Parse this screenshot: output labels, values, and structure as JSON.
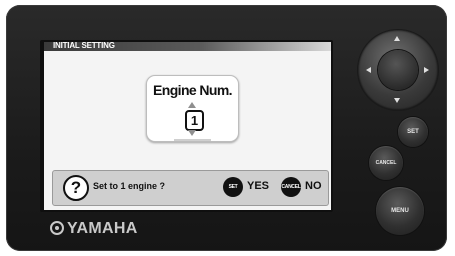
{
  "screen": {
    "title": "INITIAL SETTING",
    "panel": {
      "title": "Engine Num.",
      "value": "1"
    },
    "prompt": {
      "text": "Set to 1 engine ?",
      "set_button": "SET",
      "yes_label": "YES",
      "cancel_button": "CANCEL",
      "no_label": "NO"
    }
  },
  "brand": {
    "logo_text": "YAMAHA"
  },
  "controls": {
    "set_label": "SET",
    "cancel_label": "CANCEL",
    "menu_label": "MENU"
  },
  "colors": {
    "housing": "#1b1b1b",
    "screen_bg": "#f4f4f4",
    "bar_gray": "#cfcfcf",
    "logo": "#c9c9c9"
  }
}
